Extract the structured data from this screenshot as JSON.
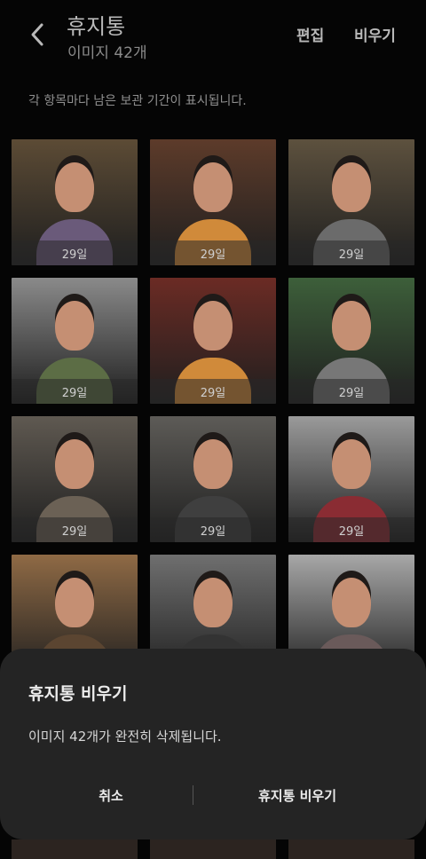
{
  "header": {
    "back_icon": "chevron-left-icon",
    "title": "휴지통",
    "subtitle": "이미지 42개",
    "edit_label": "편집",
    "empty_label": "비우기"
  },
  "info_text": "각 항목마다 남은 보관 기간이 표시됩니다.",
  "grid": {
    "items": [
      {
        "days": "29일",
        "bg": "#5c4b35",
        "accent": "#6a5a7a"
      },
      {
        "days": "29일",
        "bg": "#5d3b2a",
        "accent": "#d08a3a"
      },
      {
        "days": "29일",
        "bg": "#5d513e",
        "accent": "#6b6b6b"
      },
      {
        "days": "29일",
        "bg": "#8a8a8a",
        "accent": "#5c6d45"
      },
      {
        "days": "29일",
        "bg": "#6b2b24",
        "accent": "#d08a3a"
      },
      {
        "days": "29일",
        "bg": "#3d5f3a",
        "accent": "#777777"
      },
      {
        "days": "29일",
        "bg": "#5f5951",
        "accent": "#6b6155"
      },
      {
        "days": "29일",
        "bg": "#5d5b57",
        "accent": "#3f3f3f"
      },
      {
        "days": "29일",
        "bg": "#9a9a9a",
        "accent": "#8a2c33"
      },
      {
        "days": "",
        "bg": "#8f6a45",
        "accent": "#5b4531"
      },
      {
        "days": "",
        "bg": "#6f6f6f",
        "accent": "#333333"
      },
      {
        "days": "",
        "bg": "#a7a7a7",
        "accent": "#6a5a5a"
      }
    ]
  },
  "dialog": {
    "title": "휴지통 비우기",
    "message": "이미지 42개가 완전히 삭제됩니다.",
    "cancel_label": "취소",
    "confirm_label": "휴지통 비우기"
  }
}
